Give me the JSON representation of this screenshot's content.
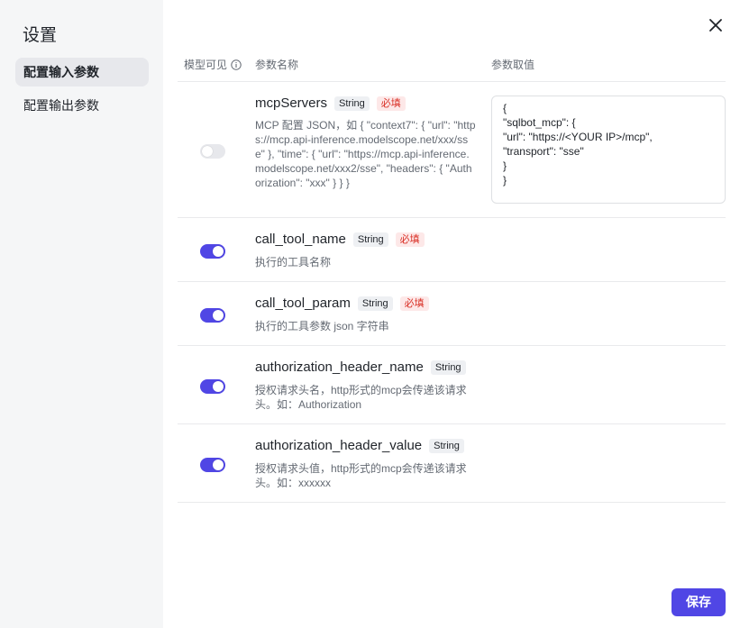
{
  "sidebar": {
    "title": "设置",
    "items": [
      {
        "label": "配置输入参数",
        "active": true
      },
      {
        "label": "配置输出参数",
        "active": false
      }
    ]
  },
  "table": {
    "headers": {
      "visible": "模型可见",
      "name": "参数名称",
      "value": "参数取值"
    },
    "rows": [
      {
        "name": "mcpServers",
        "type": "String",
        "required_label": "必填",
        "visible_on": false,
        "description": "MCP 配置 JSON，如 { \"context7\": { \"url\": \"https://mcp.api-inference.modelscope.net/xxx/sse\" }, \"time\": { \"url\": \"https://mcp.api-inference.modelscope.net/xxx2/sse\", \"headers\": { \"Authorization\": \"xxx\" } } }",
        "value": "{\n\"sqlbot_mcp\": {\n\"url\": \"https://<YOUR IP>/mcp\",\n\"transport\": \"sse\"\n}\n}"
      },
      {
        "name": "call_tool_name",
        "type": "String",
        "required_label": "必填",
        "visible_on": true,
        "description": "执行的工具名称"
      },
      {
        "name": "call_tool_param",
        "type": "String",
        "required_label": "必填",
        "visible_on": true,
        "description": "执行的工具参数 json 字符串"
      },
      {
        "name": "authorization_header_name",
        "type": "String",
        "visible_on": true,
        "description": "授权请求头名，http形式的mcp会传递该请求头。如：Authorization"
      },
      {
        "name": "authorization_header_value",
        "type": "String",
        "visible_on": true,
        "description": "授权请求头值，http形式的mcp会传递该请求头。如：xxxxxx"
      }
    ]
  },
  "footer": {
    "save_label": "保存"
  },
  "colors": {
    "accent": "#5046e5",
    "required_text": "#d93026",
    "required_bg": "#fde8e8"
  }
}
